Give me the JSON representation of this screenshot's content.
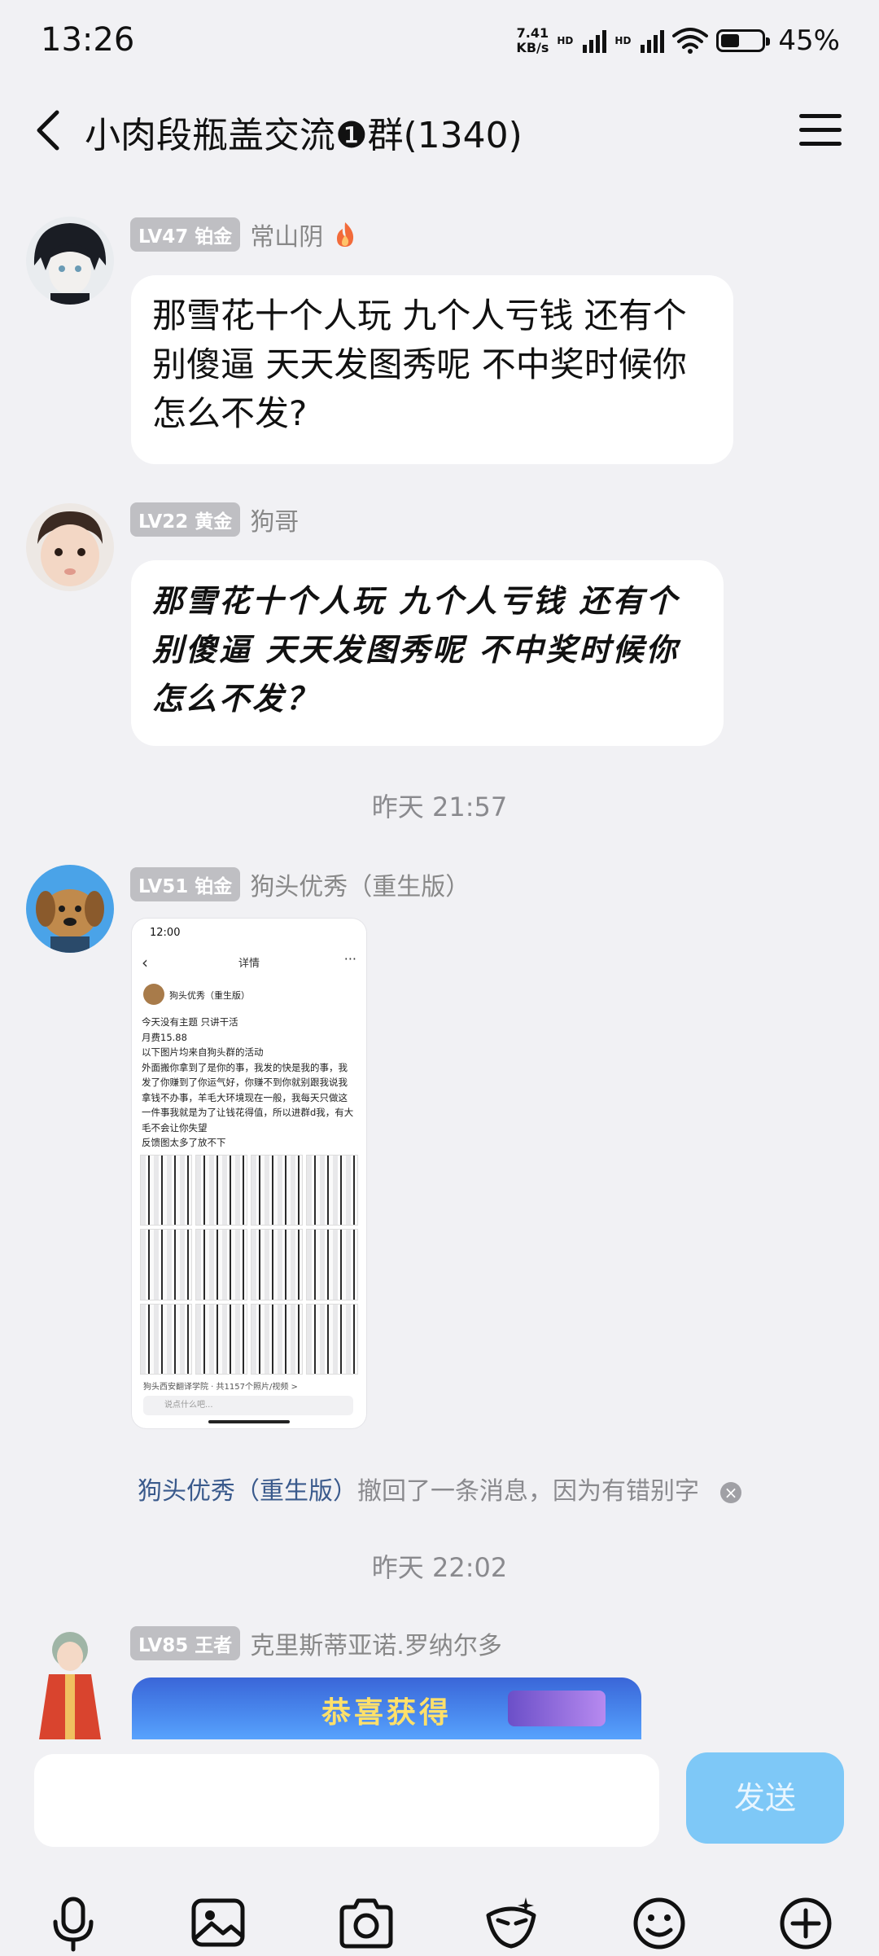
{
  "status_bar": {
    "time": "13:26",
    "speed_value": "7.41",
    "speed_unit": "KB/s",
    "hd1": "HD",
    "hd2": "HD",
    "battery_pct": "45%",
    "battery_level": 0.45
  },
  "header": {
    "title": "小肉段瓶盖交流❶群(1340)"
  },
  "messages": [
    {
      "level": "LV47 铂金",
      "name": "常山阴",
      "text": "那雪花十个人玩  九个人亏钱 还有个别傻逼 天天发图秀呢 不中奖时候你怎么不发?"
    },
    {
      "level": "LV22 黄金",
      "name": "狗哥",
      "text": "那雪花十个人玩  九个人亏钱 还有个别傻逼 天天发图秀呢 不中奖时候你怎么不发？"
    },
    {
      "level": "LV51 铂金",
      "name": "狗头优秀（重生版）"
    },
    {
      "level": "LV85 王者",
      "name": "克里斯蒂亚诺.罗纳尔多"
    }
  ],
  "timestamps": [
    "昨天 21:57",
    "昨天 22:02"
  ],
  "recall": {
    "who": "狗头优秀（重生版）",
    "text": "撤回了一条消息，因为有错别字"
  },
  "image_preview": {
    "status_time": "12:00",
    "title": "详情",
    "author": "狗头优秀（重生版）",
    "body": "今天没有主题 只讲干活\n月费15.88\n以下图片均来自狗头群的活动\n外面搬你拿到了是你的事，我发的快是我的事，我发了你赚到了你运气好，你赚不到你就别跟我说我拿钱不办事，羊毛大环境现在一般，我每天只做这一件事我就是为了让钱花得值，所以进群d我，有大毛不会让你失望\n反馈图太多了放不下",
    "footer": "狗头西安翻译学院 · 共1157个照片/视频 >",
    "input_placeholder": "说点什么吧..."
  },
  "banner": {
    "title": "恭喜获得"
  },
  "composer": {
    "input_value": "",
    "send_label": "发送"
  },
  "icons": [
    "back-icon",
    "menu-icon",
    "fire-icon",
    "mic-icon",
    "image-icon",
    "camera-icon",
    "sticker-icon",
    "emoji-icon",
    "plus-icon",
    "close-icon"
  ]
}
